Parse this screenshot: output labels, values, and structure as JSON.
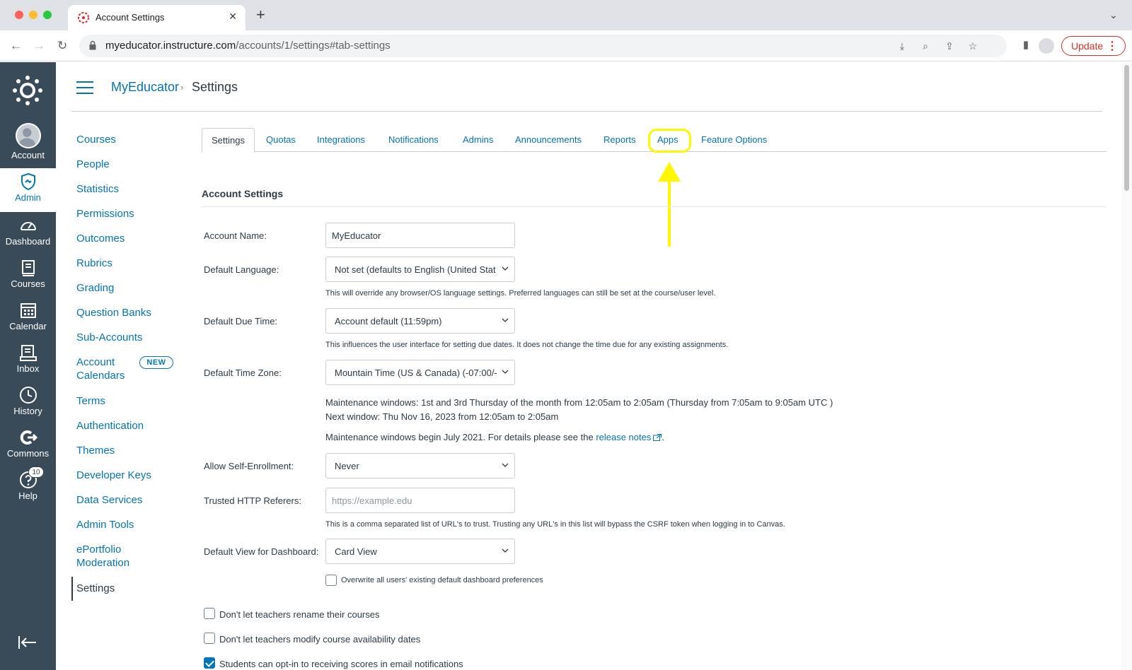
{
  "browser": {
    "tab_title": "Account Settings",
    "url_domain": "myeducator.instructure.com",
    "url_path": "/accounts/1/settings#tab-settings",
    "update_label": "Update"
  },
  "global_nav": {
    "items": [
      {
        "label": "Account",
        "icon": "user-avatar-icon"
      },
      {
        "label": "Admin",
        "icon": "admin-shield-icon"
      },
      {
        "label": "Dashboard",
        "icon": "dashboard-gauge-icon"
      },
      {
        "label": "Courses",
        "icon": "courses-book-icon"
      },
      {
        "label": "Calendar",
        "icon": "calendar-icon"
      },
      {
        "label": "Inbox",
        "icon": "inbox-icon"
      },
      {
        "label": "History",
        "icon": "history-clock-icon"
      },
      {
        "label": "Commons",
        "icon": "commons-icon"
      },
      {
        "label": "Help",
        "icon": "help-icon"
      }
    ],
    "help_badge": "10",
    "active": "Admin"
  },
  "breadcrumb": {
    "root": "MyEducator",
    "separator": "›",
    "current": "Settings"
  },
  "subnav": {
    "items": [
      "Courses",
      "People",
      "Statistics",
      "Permissions",
      "Outcomes",
      "Rubrics",
      "Grading",
      "Question Banks",
      "Sub-Accounts",
      "Account",
      "Calendars",
      "Terms",
      "Authentication",
      "Themes",
      "Developer Keys",
      "Data Services",
      "Admin Tools",
      "ePortfolio",
      "Moderation",
      "Settings"
    ],
    "new_badge": "NEW",
    "active": "Settings"
  },
  "tabs": {
    "items": [
      "Settings",
      "Quotas",
      "Integrations",
      "Notifications",
      "Admins",
      "Announcements",
      "Reports",
      "Apps",
      "Feature Options"
    ],
    "active": "Settings",
    "highlighted": "Apps"
  },
  "form": {
    "section_title": "Account Settings",
    "account_name_label": "Account Name:",
    "account_name_value": "MyEducator",
    "default_language_label": "Default Language:",
    "default_language_value": "Not set (defaults to English (United Stat",
    "default_language_hint": "This will override any browser/OS language settings. Preferred languages can still be set at the course/user level.",
    "due_time_label": "Default Due Time:",
    "due_time_value": "Account default (11:59pm)",
    "due_time_hint": "This influences the user interface for setting due dates. It does not change the time due for any existing assignments.",
    "time_zone_label": "Default Time Zone:",
    "time_zone_value": "Mountain Time (US & Canada) (-07:00/-",
    "maintenance_line1": "Maintenance windows: 1st and 3rd Thursday of the month from 12:05am to 2:05am (Thursday from 7:05am to 9:05am UTC )",
    "maintenance_line2": "Next window: Thu Nov 16, 2023 from 12:05am to 2:05am",
    "maintenance_line3": "Maintenance windows begin July 2021. For details please see the",
    "release_notes_link": "release notes",
    "period": ".",
    "self_enrollment_label": "Allow Self-Enrollment:",
    "self_enrollment_value": "Never",
    "trusted_referers_label": "Trusted HTTP Referers:",
    "trusted_referers_placeholder": "https://example.edu",
    "trusted_referers_hint": "This is a comma separated list of URL's to trust. Trusting any URL's in this list will bypass the CSRF token when logging in to Canvas.",
    "dashboard_view_label": "Default View for Dashboard:",
    "dashboard_view_value": "Card View",
    "overwrite_label": "Overwrite all users' existing default dashboard preferences",
    "overwrite_checked": false,
    "checkboxes": [
      {
        "label": "Don't let teachers rename their courses",
        "checked": false
      },
      {
        "label": "Don't let teachers modify course availability dates",
        "checked": false
      },
      {
        "label": "Students can opt-in to receiving scores in email notifications",
        "checked": true
      }
    ]
  },
  "colors": {
    "canvas_nav": "#394b58",
    "link_blue": "#0374b5",
    "highlight_yellow": "#fff600"
  }
}
